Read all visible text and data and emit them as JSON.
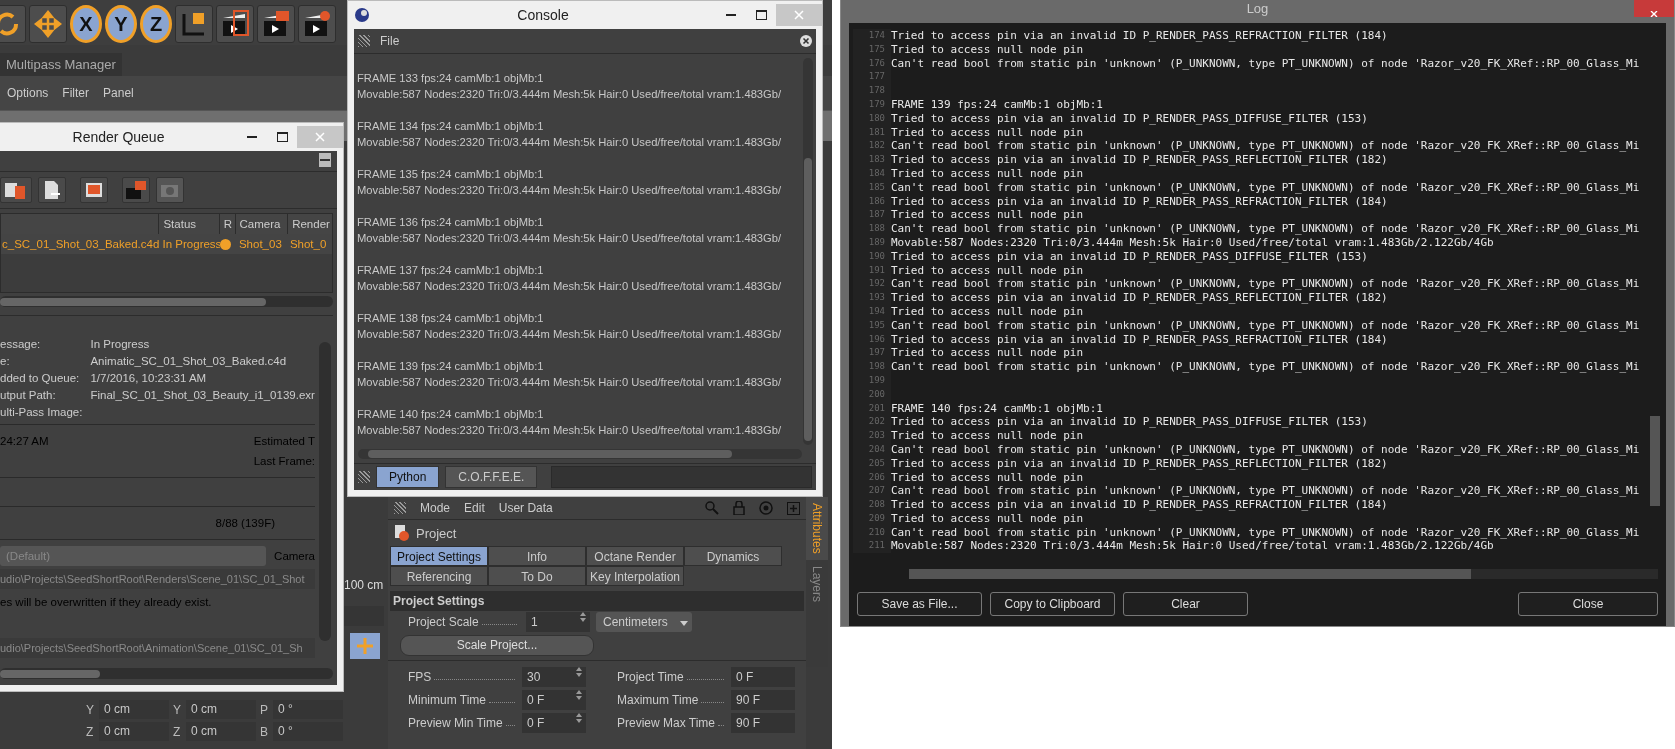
{
  "main_app": {
    "toolbar": [
      {
        "kind": "rotate"
      },
      {
        "kind": "move"
      },
      {
        "kind": "axis",
        "label": "X",
        "selected": true
      },
      {
        "kind": "axis",
        "label": "Y",
        "selected": true
      },
      {
        "kind": "axis",
        "label": "Z",
        "selected": true
      },
      {
        "kind": "coordinates"
      },
      {
        "kind": "render_view"
      },
      {
        "kind": "render"
      },
      {
        "kind": "render_settings"
      }
    ],
    "tab": "Multipass Manager",
    "menu": [
      "Options",
      "Filter",
      "Panel"
    ],
    "scale_value": "100 cm",
    "coordinates": [
      {
        "cells": [
          {
            "axis": "Y",
            "value": "0 cm"
          },
          {
            "axis": "Y",
            "value": "0 cm"
          },
          {
            "axis": "P",
            "value": "0 °"
          }
        ]
      },
      {
        "cells": [
          {
            "axis": "Z",
            "value": "0 cm"
          },
          {
            "axis": "Z",
            "value": "0 cm"
          },
          {
            "axis": "B",
            "value": "0 °"
          }
        ]
      }
    ]
  },
  "render_queue": {
    "title": "Render Queue",
    "columns": [
      "Status",
      "R",
      "Camera",
      "Render"
    ],
    "rows": [
      {
        "name": "c_SC_01_Shot_03_Baked.c4d",
        "status": "In Progress",
        "camera": "Shot_03",
        "render": "Shot_0"
      }
    ],
    "details": [
      {
        "label": "essage:",
        "value": "In Progress"
      },
      {
        "label": "e:",
        "value": "Animatic_SC_01_Shot_03_Baked.c4d"
      },
      {
        "label": "dded to Queue:",
        "value": "1/7/2016, 10:23:31 AM"
      },
      {
        "label": "utput Path:",
        "value": "Final_SC_01_Shot_03_Beauty_i1_0139.exr"
      },
      {
        "label": "ulti-Pass Image:"
      }
    ],
    "time": "24:27 AM",
    "estimated_label": "Estimated T",
    "last_frame_label": "Last Frame:",
    "frames": "8/88 (139F)",
    "preset": "(Default)",
    "camera_label": "Camera",
    "render_path": "udio\\Projects\\SeedShortRoot\\Renders\\Scene_01\\SC_01_Shot",
    "note": "es will be overwritten if they already exist.",
    "scene_path": "udio\\Projects\\SeedShortRoot\\Animation\\Scene_01\\SC_01_Sh"
  },
  "console": {
    "title": "Console",
    "menu": [
      "File"
    ],
    "lines": [
      "FRAME 133 fps:24 camMb:1 objMb:1",
      "Movable:587 Nodes:2320 Tri:0/3.444m Mesh:5k Hair:0 Used/free/total vram:1.483Gb/",
      "FRAME 134 fps:24 camMb:1 objMb:1",
      "Movable:587 Nodes:2320 Tri:0/3.444m Mesh:5k Hair:0 Used/free/total vram:1.483Gb/",
      "FRAME 135 fps:24 camMb:1 objMb:1",
      "Movable:587 Nodes:2320 Tri:0/3.444m Mesh:5k Hair:0 Used/free/total vram:1.483Gb/",
      "FRAME 136 fps:24 camMb:1 objMb:1",
      "Movable:587 Nodes:2320 Tri:0/3.444m Mesh:5k Hair:0 Used/free/total vram:1.483Gb/",
      "FRAME 137 fps:24 camMb:1 objMb:1",
      "Movable:587 Nodes:2320 Tri:0/3.444m Mesh:5k Hair:0 Used/free/total vram:1.483Gb/",
      "FRAME 138 fps:24 camMb:1 objMb:1",
      "Movable:587 Nodes:2320 Tri:0/3.444m Mesh:5k Hair:0 Used/free/total vram:1.483Gb/",
      "FRAME 139 fps:24 camMb:1 objMb:1",
      "Movable:587 Nodes:2320 Tri:0/3.444m Mesh:5k Hair:0 Used/free/total vram:1.483Gb/",
      "FRAME 140 fps:24 camMb:1 objMb:1",
      "Movable:587 Nodes:2320 Tri:0/3.444m Mesh:5k Hair:0 Used/free/total vram:1.483Gb/"
    ],
    "tabs": [
      {
        "label": "Python",
        "selected": true
      },
      {
        "label": "C.O.F.F.E.E.",
        "selected": false
      }
    ]
  },
  "attributes": {
    "menu": [
      "Mode",
      "Edit",
      "User Data"
    ],
    "object": "Project",
    "tabs": [
      {
        "label": "Project Settings",
        "selected": true
      },
      {
        "label": "Info",
        "selected": false
      },
      {
        "label": "Octane Render",
        "selected": false
      },
      {
        "label": "Dynamics",
        "selected": false
      },
      {
        "label": "Referencing",
        "selected": false
      },
      {
        "label": "To Do",
        "selected": false
      },
      {
        "label": "Key Interpolation",
        "selected": false
      }
    ],
    "section": "Project Settings",
    "scale": {
      "label": "Project Scale",
      "value": "1",
      "unit": "Centimeters"
    },
    "scale_button": "Scale Project...",
    "fields": [
      {
        "label": "FPS",
        "value": "30",
        "kind": "spinner"
      },
      {
        "label": "Project Time",
        "value": "0 F",
        "kind": "plain"
      },
      {
        "label": "Minimum Time",
        "value": "0 F",
        "kind": "spinner"
      },
      {
        "label": "Maximum Time",
        "value": "90 F",
        "kind": "plain"
      },
      {
        "label": "Preview Min Time",
        "value": "0 F",
        "kind": "spinner"
      },
      {
        "label": "Preview Max Time",
        "value": "90 F",
        "kind": "plain"
      }
    ],
    "side_tabs": [
      {
        "label": "Attributes",
        "selected": true
      },
      {
        "label": "Layers",
        "selected": false
      }
    ]
  },
  "log": {
    "title": "Log",
    "lines": [
      {
        "number": "174",
        "text": "Tried to access pin via an invalid ID P_RENDER_PASS_REFRACTION_FILTER (184)"
      },
      {
        "number": "175",
        "text": "Tried to access null node pin"
      },
      {
        "number": "176",
        "text": "Can't read bool from static pin 'unknown' (P_UNKNOWN, type PT_UNKNOWN) of node 'Razor_v20_FK_XRef::RP_00_Glass_Mi"
      },
      {
        "number": "177"
      },
      {
        "number": "178"
      },
      {
        "number": "179",
        "text": "FRAME 139 fps:24 camMb:1 objMb:1"
      },
      {
        "number": "180",
        "text": "Tried to access pin via an invalid ID P_RENDER_PASS_DIFFUSE_FILTER (153)"
      },
      {
        "number": "181",
        "text": "Tried to access null node pin"
      },
      {
        "number": "182",
        "text": "Can't read bool from static pin 'unknown' (P_UNKNOWN, type PT_UNKNOWN) of node 'Razor_v20_FK_XRef::RP_00_Glass_Mi"
      },
      {
        "number": "183",
        "text": "Tried to access pin via an invalid ID P_RENDER_PASS_REFLECTION_FILTER (182)"
      },
      {
        "number": "184",
        "text": "Tried to access null node pin"
      },
      {
        "number": "185",
        "text": "Can't read bool from static pin 'unknown' (P_UNKNOWN, type PT_UNKNOWN) of node 'Razor_v20_FK_XRef::RP_00_Glass_Mi"
      },
      {
        "number": "186",
        "text": "Tried to access pin via an invalid ID P_RENDER_PASS_REFRACTION_FILTER (184)"
      },
      {
        "number": "187",
        "text": "Tried to access null node pin"
      },
      {
        "number": "188",
        "text": "Can't read bool from static pin 'unknown' (P_UNKNOWN, type PT_UNKNOWN) of node 'Razor_v20_FK_XRef::RP_00_Glass_Mi"
      },
      {
        "number": "189",
        "text": "Movable:587 Nodes:2320 Tri:0/3.444m Mesh:5k Hair:0 Used/free/total vram:1.483Gb/2.122Gb/4Gb"
      },
      {
        "number": "190",
        "text": "Tried to access pin via an invalid ID P_RENDER_PASS_DIFFUSE_FILTER (153)"
      },
      {
        "number": "191",
        "text": "Tried to access null node pin"
      },
      {
        "number": "192",
        "text": "Can't read bool from static pin 'unknown' (P_UNKNOWN, type PT_UNKNOWN) of node 'Razor_v20_FK_XRef::RP_00_Glass_Mi"
      },
      {
        "number": "193",
        "text": "Tried to access pin via an invalid ID P_RENDER_PASS_REFLECTION_FILTER (182)"
      },
      {
        "number": "194",
        "text": "Tried to access null node pin"
      },
      {
        "number": "195",
        "text": "Can't read bool from static pin 'unknown' (P_UNKNOWN, type PT_UNKNOWN) of node 'Razor_v20_FK_XRef::RP_00_Glass_Mi"
      },
      {
        "number": "196",
        "text": "Tried to access pin via an invalid ID P_RENDER_PASS_REFRACTION_FILTER (184)"
      },
      {
        "number": "197",
        "text": "Tried to access null node pin"
      },
      {
        "number": "198",
        "text": "Can't read bool from static pin 'unknown' (P_UNKNOWN, type PT_UNKNOWN) of node 'Razor_v20_FK_XRef::RP_00_Glass_Mi"
      },
      {
        "number": "199"
      },
      {
        "number": "200"
      },
      {
        "number": "201",
        "text": "FRAME 140 fps:24 camMb:1 objMb:1"
      },
      {
        "number": "202",
        "text": "Tried to access pin via an invalid ID P_RENDER_PASS_DIFFUSE_FILTER (153)"
      },
      {
        "number": "203",
        "text": "Tried to access null node pin"
      },
      {
        "number": "204",
        "text": "Can't read bool from static pin 'unknown' (P_UNKNOWN, type PT_UNKNOWN) of node 'Razor_v20_FK_XRef::RP_00_Glass_Mi"
      },
      {
        "number": "205",
        "text": "Tried to access pin via an invalid ID P_RENDER_PASS_REFLECTION_FILTER (182)"
      },
      {
        "number": "206",
        "text": "Tried to access null node pin"
      },
      {
        "number": "207",
        "text": "Can't read bool from static pin 'unknown' (P_UNKNOWN, type PT_UNKNOWN) of node 'Razor_v20_FK_XRef::RP_00_Glass_Mi"
      },
      {
        "number": "208",
        "text": "Tried to access pin via an invalid ID P_RENDER_PASS_REFRACTION_FILTER (184)"
      },
      {
        "number": "209",
        "text": "Tried to access null node pin"
      },
      {
        "number": "210",
        "text": "Can't read bool from static pin 'unknown' (P_UNKNOWN, type PT_UNKNOWN) of node 'Razor_v20_FK_XRef::RP_00_Glass_Mi"
      },
      {
        "number": "211",
        "text": "Movable:587 Nodes:2320 Tri:0/3.444m Mesh:5k Hair:0 Used/free/total vram:1.483Gb/2.122Gb/4Gb"
      }
    ],
    "buttons": [
      "Save as File...",
      "Copy to Clipboard",
      "Clear"
    ],
    "close_button": "Close"
  }
}
